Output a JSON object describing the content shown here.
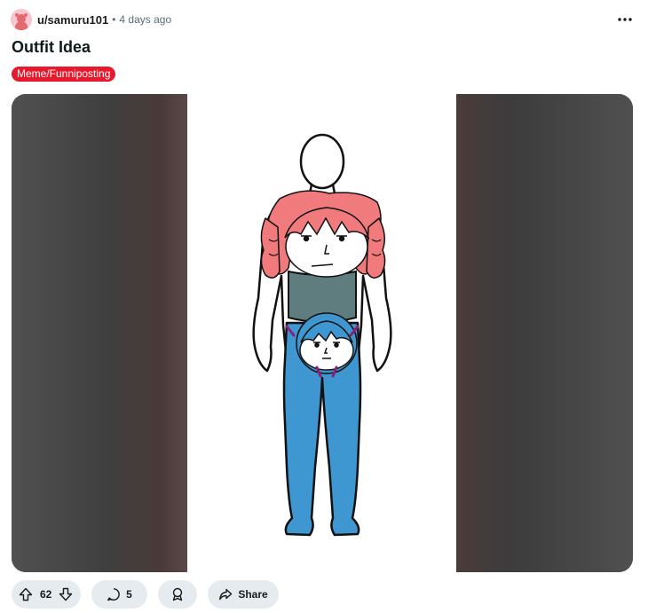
{
  "post": {
    "username": "u/samuru101",
    "separator": "•",
    "time_ago": "4 days ago",
    "title": "Outfit Idea",
    "flair": "Meme/Funniposting"
  },
  "actions": {
    "upvote_count": "62",
    "comment_count": "5",
    "share_label": "Share"
  },
  "colors": {
    "flair_bg": "#e8192c",
    "pill_bg": "#e5ebee",
    "pink_hair": "#f07a7c",
    "blue_outfit": "#3f97d1",
    "gray_shirt": "#5f7c7e"
  },
  "icons": [
    "avatar-icon",
    "more-options-icon",
    "upvote-icon",
    "downvote-icon",
    "comment-icon",
    "award-icon",
    "share-icon"
  ]
}
